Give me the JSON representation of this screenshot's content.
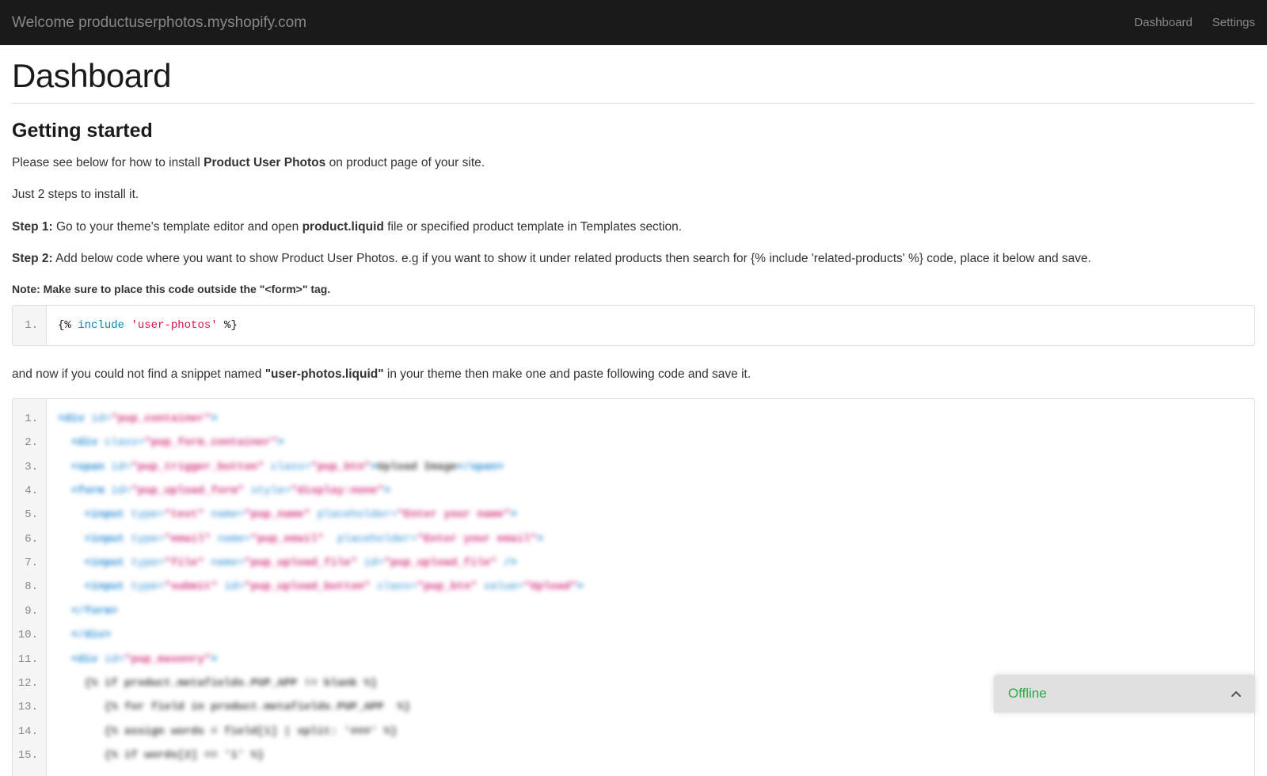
{
  "navbar": {
    "welcome": "Welcome productuserphotos.myshopify.com",
    "links": {
      "dashboard": "Dashboard",
      "settings": "Settings"
    }
  },
  "page": {
    "title": "Dashboard"
  },
  "getting_started": {
    "heading": "Getting started",
    "intro_pre": "Please see below for how to install ",
    "intro_strong": "Product User Photos",
    "intro_post": " on product page of your site.",
    "steps_hint": "Just 2 steps to install it.",
    "step1_label": "Step 1:",
    "step1_pre": " Go to your theme's template editor and open ",
    "step1_strong": "product.liquid",
    "step1_post": " file or specified product template in Templates section.",
    "step2_label": "Step 2:",
    "step2_text": " Add below code where you want to show Product User Photos. e.g if you want to show it under related products then search for {% include 'related-products' %} code, place it below and save.",
    "note": "Note: Make sure to place this code outside the \"<form>\" tag."
  },
  "code_snippet1": {
    "line1_open": "{% ",
    "line1_kw": "include",
    "line1_mid": " ",
    "line1_str": "'user-photos'",
    "line1_close": " %}"
  },
  "snippet_instr": {
    "pre": "and now if you could not find a snippet named ",
    "strong": "\"user-photos.liquid\"",
    "post": " in your theme then make one and paste following code and save it."
  },
  "code_snippet2_lines": [
    "1.",
    "2.",
    "3.",
    "4.",
    "5.",
    "6.",
    "7.",
    "8.",
    "9.",
    "10.",
    "11.",
    "12.",
    "13.",
    "14.",
    "15."
  ],
  "chat": {
    "status": "Offline"
  }
}
